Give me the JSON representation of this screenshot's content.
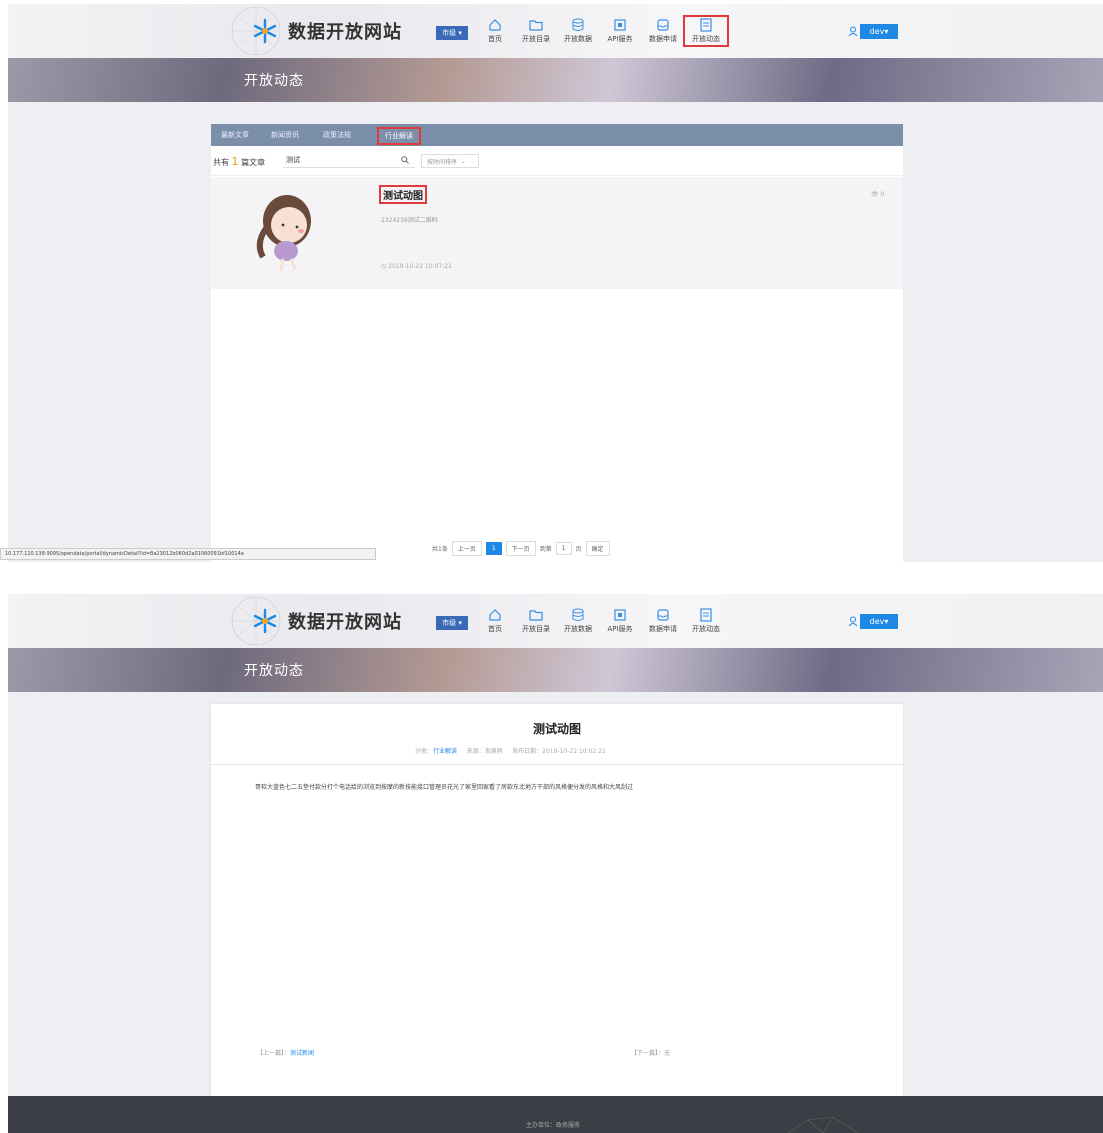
{
  "site": {
    "title": "数据开放网站",
    "city_selector": "市级",
    "user": "dev"
  },
  "nav": [
    {
      "label": "首页",
      "icon": "home-icon"
    },
    {
      "label": "开放目录",
      "icon": "folder-icon"
    },
    {
      "label": "开放数据",
      "icon": "database-icon"
    },
    {
      "label": "API服务",
      "icon": "chip-icon"
    },
    {
      "label": "数据申请",
      "icon": "inbox-icon"
    },
    {
      "label": "开放动态",
      "icon": "document-icon",
      "active": true
    }
  ],
  "banner_title": "开放动态",
  "list_page": {
    "tabs": [
      "最新文章",
      "新闻资讯",
      "政策法规",
      "行业解读"
    ],
    "active_tab": "行业解读",
    "total_prefix": "共有",
    "total_count": "1",
    "total_suffix": "篇文章",
    "search_value": "测试",
    "sort_placeholder": "按时间排序",
    "article": {
      "title": "测试动图",
      "summary": "2324239测试二维码",
      "date": "2019-10-22 10:07:21",
      "views": "0"
    },
    "pager": {
      "total": "共1条",
      "prev": "上一页",
      "current": "1",
      "next": "下一页",
      "goto": "到第",
      "page_input": "1",
      "page_unit": "页",
      "confirm": "确定"
    },
    "status_url": "10.177.120.138:9095/opendata/portal/dynamicDetail?id=8a23012b060d2a01060091bf10014a"
  },
  "detail_page": {
    "title": "测试动图",
    "meta_category_label": "分类：",
    "meta_category": "行业解读",
    "meta_source": "来源：发展网",
    "meta_date": "发布日期：2019-10-22 10:02:21",
    "body": "哥软大蓝色七二五垫付款分打个电话给的浏览到按摩的新技能接口管理员花光了家里回家看了房款东北地方干部的风格便分发的风格和大风刮过",
    "prev_label": "【上一篇】：",
    "prev_title": "测试新闻",
    "next_label": "【下一篇】：",
    "next_title": "无",
    "footer_text": "主办单位：政务服务"
  },
  "colors": {
    "accent": "#1e88e5",
    "tab_bar": "#7b8fab",
    "highlight": "#e03a3a",
    "count": "#e89b12",
    "footer": "#3b3e44"
  }
}
